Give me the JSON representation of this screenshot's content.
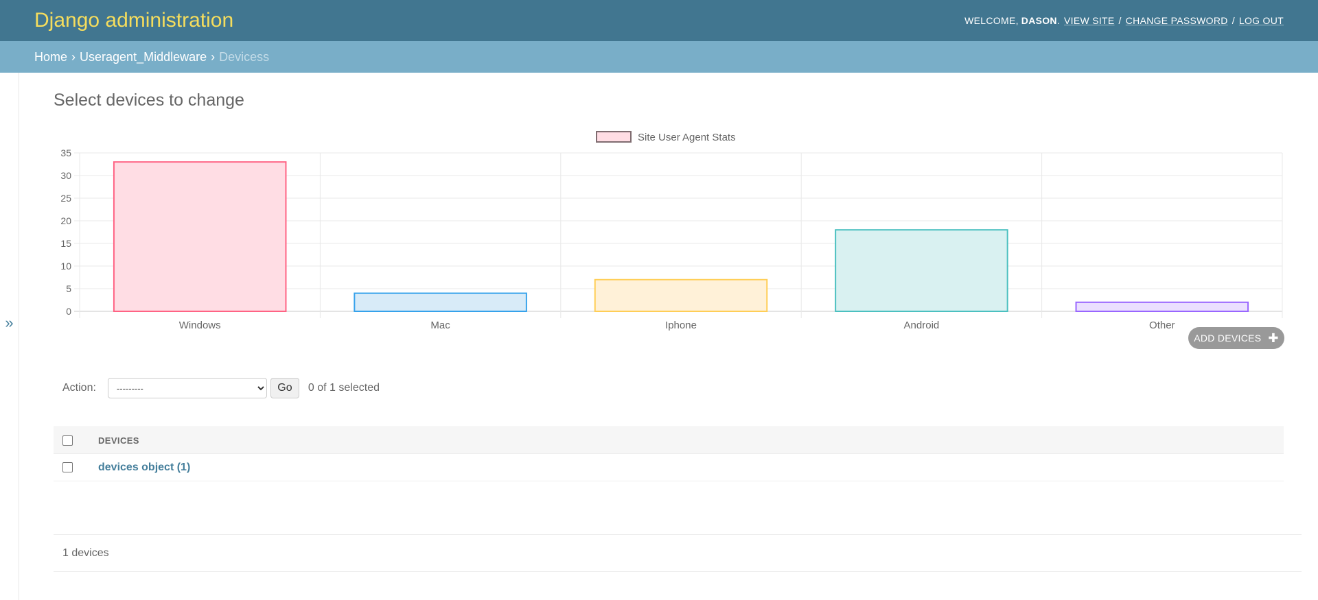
{
  "header": {
    "site_name": "Django administration",
    "welcome": "WELCOME,",
    "username": "DASON",
    "view_site": "VIEW SITE",
    "change_password": "CHANGE PASSWORD",
    "log_out": "LOG OUT",
    "separator": "/"
  },
  "breadcrumbs": {
    "home": "Home",
    "app": "Useragent_Middleware",
    "current": "Devicess"
  },
  "sidebar": {
    "toggle_icon": "double-chevron-right-icon",
    "toggle_glyph": "»"
  },
  "page": {
    "title": "Select devices to change",
    "add_button": "ADD DEVICES",
    "add_icon": "plus-icon"
  },
  "actions": {
    "label": "Action:",
    "selected_option": "---------",
    "go": "Go",
    "selected_count": "0 of 1 selected"
  },
  "table": {
    "columns": [
      "DEVICES"
    ],
    "rows": [
      {
        "label": "devices object (1)"
      }
    ]
  },
  "paginator": {
    "count_text": "1 devices"
  },
  "colors": {
    "header_bg": "#417690",
    "breadcrumb_bg": "#79aec8",
    "brand_text": "#f5dd5d",
    "link": "#447e9b"
  },
  "chart_data": {
    "type": "bar",
    "categories": [
      "Windows",
      "Mac",
      "Iphone",
      "Android",
      "Other"
    ],
    "series": [
      {
        "name": "Site User Agent Stats",
        "values": [
          33,
          4,
          7,
          18,
          2
        ]
      }
    ],
    "bar_fill_colors": [
      "#ffdde4",
      "#d8ebf8",
      "#fff1d8",
      "#d9f1f1",
      "#ebe0ff"
    ],
    "bar_stroke_colors": [
      "#ff6384",
      "#36a2eb",
      "#ffce56",
      "#4bc0c0",
      "#9966ff"
    ],
    "legend_color_fill": "#ffdde4",
    "legend_color_stroke": "#7f6c70",
    "ylim": [
      0,
      35
    ],
    "yticks": [
      0,
      5,
      10,
      15,
      20,
      25,
      30,
      35
    ],
    "grid": true,
    "legend_position": "top-center"
  }
}
